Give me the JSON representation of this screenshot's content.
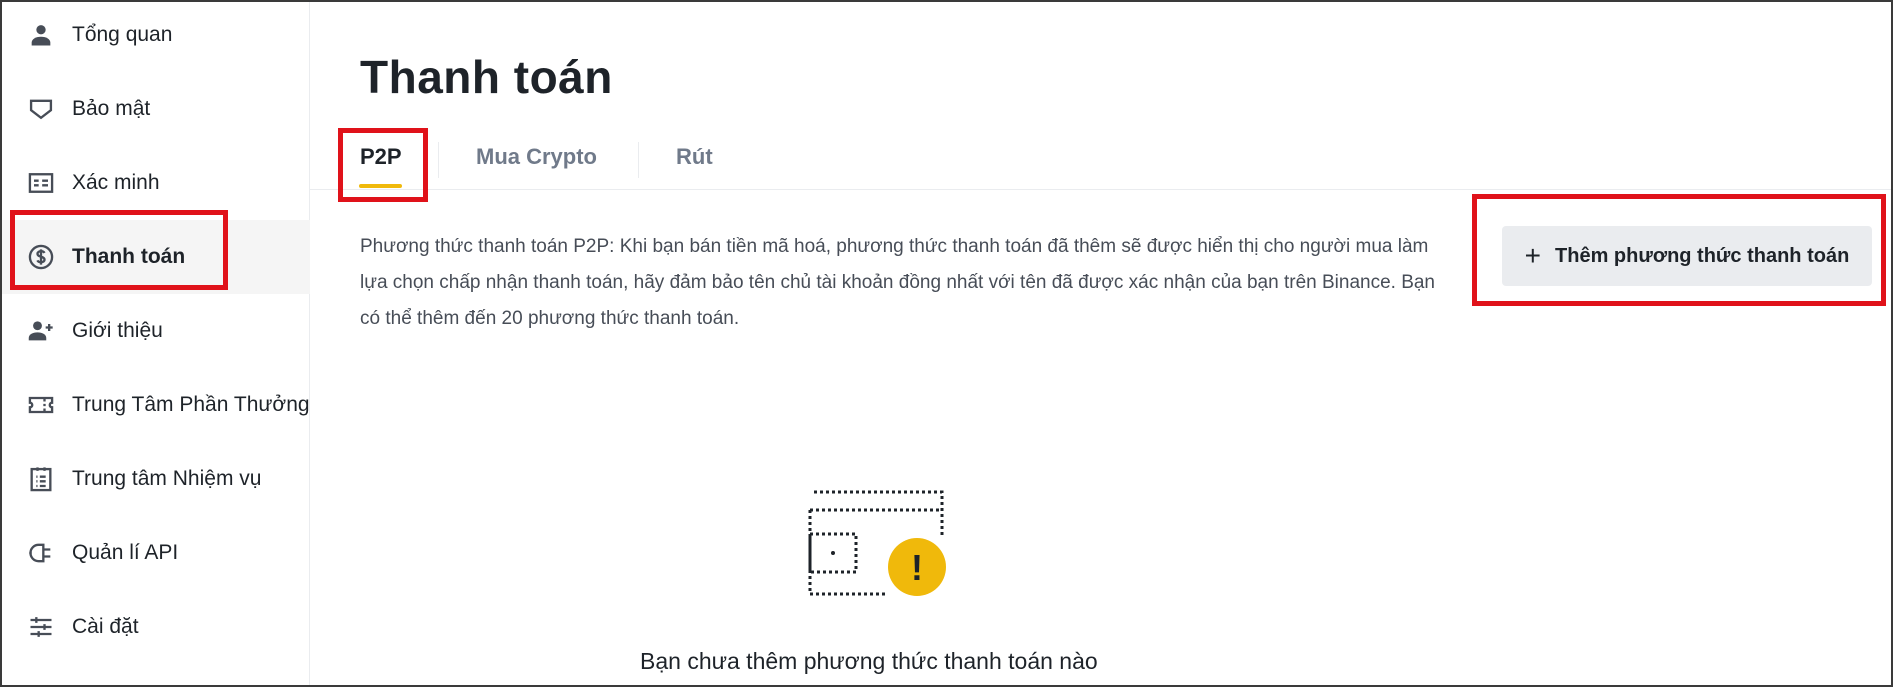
{
  "sidebar": {
    "items": [
      {
        "label": "Tổng quan",
        "icon": "user-icon"
      },
      {
        "label": "Bảo mật",
        "icon": "shield-icon"
      },
      {
        "label": "Xác minh",
        "icon": "id-card-icon"
      },
      {
        "label": "Thanh toán",
        "icon": "dollar-circle-icon",
        "active": true
      },
      {
        "label": "Giới thiệu",
        "icon": "add-user-icon"
      },
      {
        "label": "Trung Tâm Phần Thưởng",
        "icon": "ticket-icon"
      },
      {
        "label": "Trung tâm Nhiệm vụ",
        "icon": "clipboard-icon"
      },
      {
        "label": "Quản lí API",
        "icon": "plug-icon"
      },
      {
        "label": "Cài đặt",
        "icon": "sliders-icon"
      }
    ]
  },
  "main": {
    "title": "Thanh toán",
    "tabs": [
      {
        "label": "P2P",
        "active": true
      },
      {
        "label": "Mua Crypto"
      },
      {
        "label": "Rút"
      }
    ],
    "description": "Phương thức thanh toán P2P: Khi bạn bán tiền mã hoá, phương thức thanh toán đã thêm sẽ được hiển thị cho người mua làm lựa chọn chấp nhận thanh toán, hãy đảm bảo tên chủ tài khoản đồng nhất với tên đã được xác nhận của bạn trên Binance. Bạn có thể thêm đến 20 phương thức thanh toán.",
    "add_button_icon": "+",
    "add_button_label": "Thêm phương thức thanh toán",
    "empty_state": {
      "icon": "empty-wallet-warning-icon",
      "warning_glyph": "!",
      "text": "Bạn chưa thêm phương thức thanh toán nào"
    }
  },
  "colors": {
    "accent": "#f0b90b",
    "highlight": "#e0121a",
    "button_bg": "#eaecef",
    "text_primary": "#1e2329",
    "text_secondary": "#707a8a"
  }
}
